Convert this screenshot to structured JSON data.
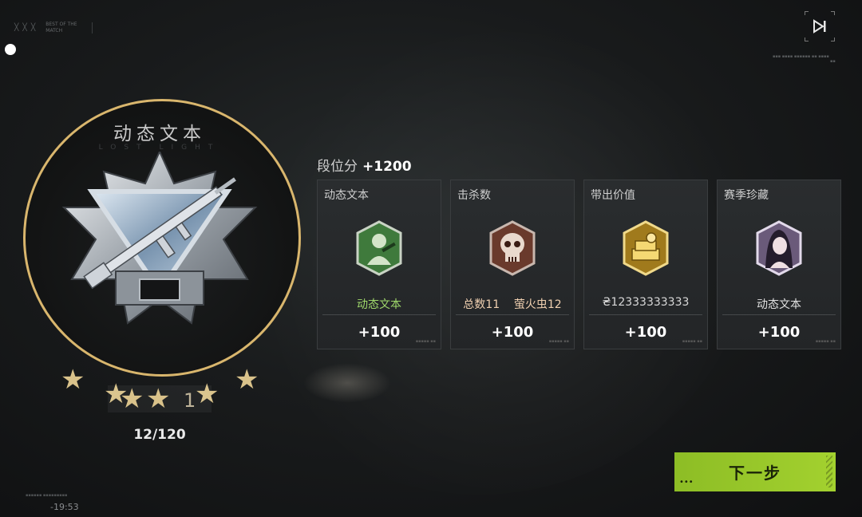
{
  "header": {
    "best_of_match": "BEST OF THE MATCH"
  },
  "emblem": {
    "title": "动态文本",
    "subtitle": "LOST LIGHT",
    "star_count": "1",
    "progress_text": "12/120",
    "ring_color": "#d9b66d"
  },
  "rank": {
    "label": "段位分",
    "value": "+1200"
  },
  "cards": [
    {
      "title": "动态文本",
      "value": "动态文本",
      "value_color": "#9fd86b",
      "points": "+100",
      "badge_icon": "soldier-badge-icon",
      "badge_color": "#3f7a3c"
    },
    {
      "title": "击杀数",
      "value": "总数11    萤火虫12",
      "value_color": "#f0d0b0",
      "points": "+100",
      "badge_icon": "skull-badge-icon",
      "badge_color": "#6a3a2c"
    },
    {
      "title": "带出价值",
      "value": "₴12333333333",
      "value_color": "#d8d8d8",
      "points": "+100",
      "badge_icon": "gold-badge-icon",
      "badge_color": "#a07a1c"
    },
    {
      "title": "赛季珍藏",
      "value": "动态文本",
      "value_color": "#e0e0e0",
      "points": "+100",
      "badge_icon": "portrait-badge-icon",
      "badge_color": "#6a5a7a"
    }
  ],
  "buttons": {
    "next_label": "下一步",
    "skip_icon": "skip-forward-icon"
  },
  "footer": {
    "timer": "-19:53"
  },
  "colors": {
    "accent_green": "#9dcb2b",
    "gold": "#d9b66d"
  }
}
